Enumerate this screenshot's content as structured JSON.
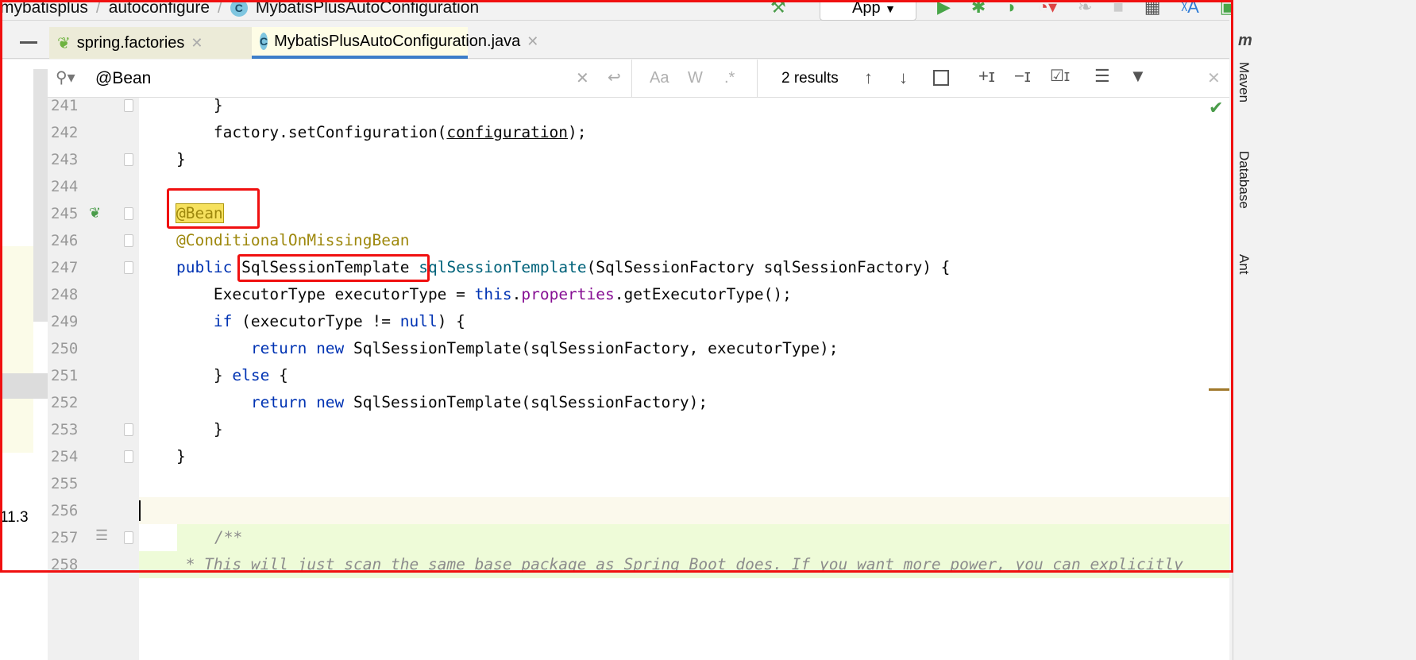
{
  "breadcrumb": [
    "mybatisplus",
    "autoconfigure",
    "MybatisPlusAutoConfiguration"
  ],
  "toolbar": {
    "run_config": "App",
    "icons": [
      "hammer-icon",
      "run-icon",
      "debug-icon",
      "coverage-icon",
      "profile-icon",
      "attach-icon",
      "stop-icon",
      "layout-icon",
      "translate-icon",
      "run-window-icon",
      "search-icon"
    ]
  },
  "tabs": [
    {
      "label": "spring.factories",
      "active": false
    },
    {
      "label": "MybatisPlusAutoConfiguration.java",
      "active": true
    }
  ],
  "search": {
    "query": "@Bean",
    "match_case": "Aa",
    "words": "W",
    "regex": ".*",
    "results": "2 results"
  },
  "right_tools": [
    "Maven",
    "Database",
    "Ant"
  ],
  "left_fragments": {
    "version": "11.3"
  },
  "colors": {
    "accent": "#3d7ec9",
    "highlight_red": "#f01010",
    "match": "#f6e15e"
  },
  "code_lines": [
    {
      "n": "241",
      "html": "        }"
    },
    {
      "n": "242",
      "html": "        factory.setConfiguration(<span class='ul'>configuration</span>);"
    },
    {
      "n": "243",
      "html": "    }"
    },
    {
      "n": "244",
      "html": ""
    },
    {
      "n": "245",
      "html": "    <span class='ann hl'>@Bean</span>"
    },
    {
      "n": "246",
      "html": "    <span class='ann'>@ConditionalOnMissingBean</span>"
    },
    {
      "n": "247",
      "html": "    <span class='kw'>public</span> SqlSessionTemplate <span class='mth'>sqlSessionTemplate</span>(SqlSessionFactory sqlSessionFactory) {"
    },
    {
      "n": "248",
      "html": "        ExecutorType executorType = <span class='kw'>this</span>.<span class='fld'>properties</span>.getExecutorType();"
    },
    {
      "n": "249",
      "html": "        <span class='kw'>if</span> (executorType != <span class='kw'>null</span>) {"
    },
    {
      "n": "250",
      "html": "            <span class='kw'>return new</span> SqlSessionTemplate(sqlSessionFactory, executorType);"
    },
    {
      "n": "251",
      "html": "        } <span class='kw'>else</span> {"
    },
    {
      "n": "252",
      "html": "            <span class='kw'>return new</span> SqlSessionTemplate(sqlSessionFactory);"
    },
    {
      "n": "253",
      "html": "        }"
    },
    {
      "n": "254",
      "html": "    }"
    },
    {
      "n": "255",
      "html": ""
    },
    {
      "n": "256",
      "html": ""
    },
    {
      "n": "257",
      "html": "    <span style='color:#8c8c8c;font-style:italic'>/**</span>"
    },
    {
      "n": "258",
      "html": "<span style='color:#8c8c8c;font-style:italic'>     * This will just scan the same base package as Spring Boot does. If you want more power, you can explicitly</span>"
    }
  ]
}
